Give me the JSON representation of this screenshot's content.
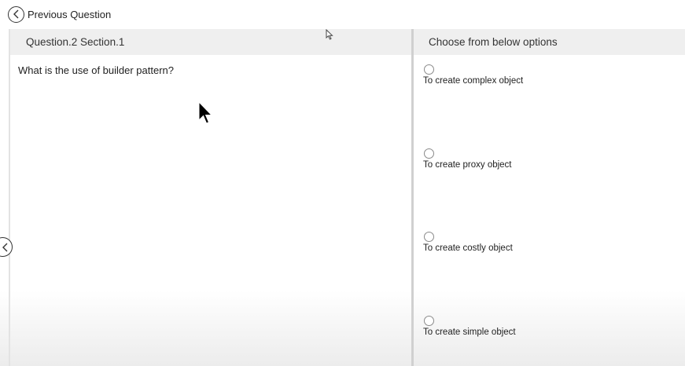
{
  "top_bar": {
    "previous_label": "Previous Question",
    "previous_icon": "chevron-left-icon"
  },
  "question_panel": {
    "header": "Question.2 Section.1",
    "question": "What is the use of builder pattern?"
  },
  "options_panel": {
    "header": "Choose from below options",
    "options": [
      {
        "label": "To create complex object",
        "selected": false
      },
      {
        "label": "To create proxy object",
        "selected": false
      },
      {
        "label": "To create costly object",
        "selected": false
      },
      {
        "label": "To create simple object",
        "selected": false
      }
    ]
  },
  "side_nav": {
    "icon": "chevron-left-icon"
  },
  "colors": {
    "header_bg": "#efefef",
    "divider": "#d0d0d0",
    "text": "#222222"
  }
}
